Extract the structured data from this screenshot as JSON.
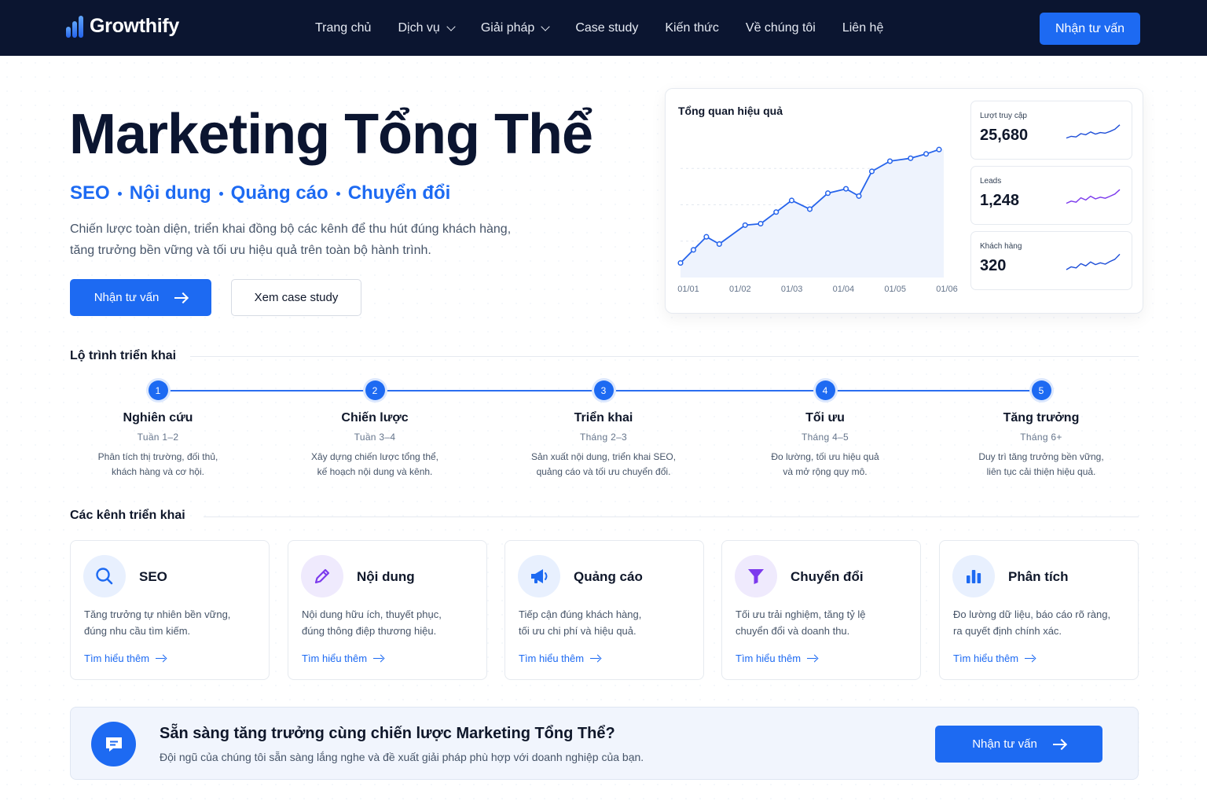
{
  "header": {
    "logo_text": "Growthify",
    "nav": [
      {
        "label": "Trang chủ",
        "has_dropdown": false
      },
      {
        "label": "Dịch vụ",
        "has_dropdown": true
      },
      {
        "label": "Giải pháp",
        "has_dropdown": true
      },
      {
        "label": "Case study",
        "has_dropdown": false
      },
      {
        "label": "Kiến thức",
        "has_dropdown": false
      },
      {
        "label": "Về chúng tôi",
        "has_dropdown": false
      },
      {
        "label": "Liên hệ",
        "has_dropdown": false
      }
    ],
    "cta_label": "Nhận tư vấn"
  },
  "hero": {
    "title": "Marketing Tổng Thể",
    "tags": [
      "SEO",
      "Nội dung",
      "Quảng cáo",
      "Chuyển đổi"
    ],
    "description_line1": "Chiến lược toàn diện, triển khai đồng bộ các kênh để thu hút đúng khách hàng,",
    "description_line2": "tăng trưởng bền vững và tối ưu hiệu quả trên toàn bộ hành trình.",
    "primary_button": "Nhận tư vấn",
    "secondary_button": "Xem case study"
  },
  "dashboard": {
    "title": "Tổng quan hiệu quả",
    "stats": [
      {
        "label": "Lượt truy cập",
        "value": "25,680",
        "color": "#1d4ed8"
      },
      {
        "label": "Leads",
        "value": "1,248",
        "color": "#7c3aed"
      },
      {
        "label": "Khách hàng",
        "value": "320",
        "color": "#1d4ed8"
      }
    ]
  },
  "chart_data": {
    "type": "area",
    "title": "Tổng quan hiệu quả",
    "categories": [
      "01/01",
      "01/02",
      "01/03",
      "01/04",
      "01/05",
      "01/06"
    ],
    "series": [
      {
        "color": "#2563eb",
        "x": [
          0,
          0.25,
          0.5,
          0.75,
          1.25,
          1.55,
          1.85,
          2.15,
          2.5,
          2.85,
          3.2,
          3.45,
          3.7,
          4.05,
          4.45,
          4.75,
          5.0
        ],
        "values": [
          10,
          19,
          28,
          23,
          36,
          37,
          45,
          53,
          47,
          58,
          61,
          56,
          73,
          80,
          82,
          85,
          88
        ]
      }
    ],
    "ylim": [
      0,
      100
    ],
    "grid": true
  },
  "stat_sparklines": [
    [
      30,
      38,
      35,
      50,
      45,
      58,
      48,
      55,
      52,
      60,
      70,
      90
    ],
    [
      30,
      40,
      35,
      55,
      45,
      62,
      50,
      58,
      53,
      62,
      72,
      92
    ],
    [
      25,
      38,
      33,
      52,
      42,
      60,
      48,
      56,
      50,
      62,
      72,
      95
    ]
  ],
  "roadmap": {
    "heading": "Lộ trình triển khai",
    "steps": [
      {
        "num": "1",
        "title": "Nghiên cứu",
        "time": "Tuần 1–2",
        "desc1": "Phân tích thị trường, đối thủ,",
        "desc2": "khách hàng và cơ hội."
      },
      {
        "num": "2",
        "title": "Chiến lược",
        "time": "Tuần 3–4",
        "desc1": "Xây dựng chiến lược tổng thể,",
        "desc2": "kế hoạch nội dung và kênh."
      },
      {
        "num": "3",
        "title": "Triển khai",
        "time": "Tháng 2–3",
        "desc1": "Sản xuất nội dung, triển khai SEO,",
        "desc2": "quảng cáo và tối ưu chuyển đổi."
      },
      {
        "num": "4",
        "title": "Tối ưu",
        "time": "Tháng 4–5",
        "desc1": "Đo lường, tối ưu hiệu quả",
        "desc2": "và mở rộng quy mô."
      },
      {
        "num": "5",
        "title": "Tăng trưởng",
        "time": "Tháng 6+",
        "desc1": "Duy trì tăng trưởng bền vững,",
        "desc2": "liên tục cải thiện hiệu quả."
      }
    ]
  },
  "channels": {
    "heading": "Các kênh triển khai",
    "link_label": "Tìm hiểu thêm",
    "items": [
      {
        "icon": "search-icon",
        "title": "SEO",
        "desc1": "Tăng trưởng tự nhiên bền vững,",
        "desc2": "đúng nhu cầu tìm kiếm.",
        "bg": "#e8f0fe",
        "fg": "#1d6af2"
      },
      {
        "icon": "pencil-icon",
        "title": "Nội dung",
        "desc1": "Nội dung hữu ích, thuyết phục,",
        "desc2": "đúng thông điệp thương hiệu.",
        "bg": "#efeafd",
        "fg": "#7c3aed"
      },
      {
        "icon": "megaphone-icon",
        "title": "Quảng cáo",
        "desc1": "Tiếp cận đúng khách hàng,",
        "desc2": "tối ưu chi phí và hiệu quả.",
        "bg": "#e8f0fe",
        "fg": "#1d6af2"
      },
      {
        "icon": "funnel-icon",
        "title": "Chuyển đổi",
        "desc1": "Tối ưu trải nghiệm, tăng tỷ lệ",
        "desc2": "chuyển đổi và doanh thu.",
        "bg": "#efeafd",
        "fg": "#7c3aed"
      },
      {
        "icon": "bar-chart-icon",
        "title": "Phân tích",
        "desc1": "Đo lường dữ liệu, báo cáo rõ ràng,",
        "desc2": "ra quyết định chính xác.",
        "bg": "#e8f0fe",
        "fg": "#1d6af2"
      }
    ]
  },
  "banner": {
    "icon": "chat-icon",
    "title": "Sẵn sàng tăng trưởng cùng chiến lược Marketing Tổng Thể?",
    "desc": "Đội ngũ của chúng tôi sẵn sàng lắng nghe và đề xuất giải pháp phù hợp với doanh nghiệp của bạn.",
    "button": "Nhận tư vấn"
  },
  "colors": {
    "primary": "#1d6af2",
    "navy": "#0b1530",
    "accent_purple": "#7c3aed"
  }
}
